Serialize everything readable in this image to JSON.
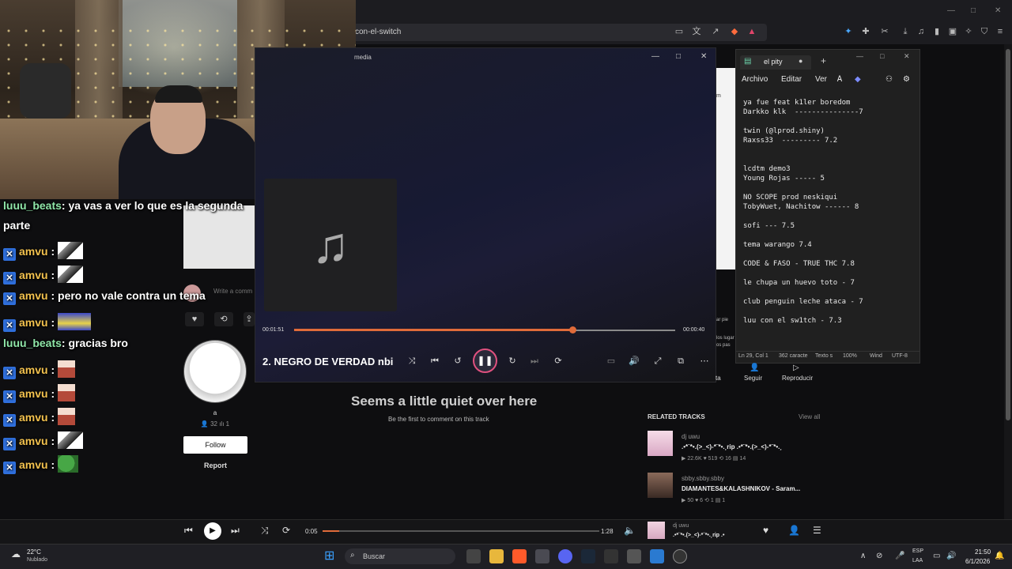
{
  "browser": {
    "url": "con-el-switch",
    "icons": [
      "screen-icon",
      "translate-icon",
      "share-icon",
      "brave-shield-icon",
      "rewards-icon",
      "extension-icon",
      "puzzle-icon",
      "download-icon",
      "music-icon",
      "sidebar-icon",
      "wallet-icon",
      "leo-icon",
      "vpn-icon",
      "menu-icon"
    ]
  },
  "chat": {
    "messages": [
      {
        "user": "luuu_beats",
        "text": ": ya vas a ver lo que es la segunda",
        "badge": false,
        "emote": ""
      },
      {
        "user": "",
        "text": "parte",
        "badge": false,
        "emote": ""
      },
      {
        "user": "amvu",
        "text": " :",
        "badge": true,
        "emote": "cat"
      },
      {
        "user": "amvu",
        "text": " :",
        "badge": true,
        "emote": "cat"
      },
      {
        "user": "amvu",
        "text": " : pero no vale contra un tema",
        "badge": true,
        "emote": ""
      },
      {
        "user": "amvu",
        "text": " :",
        "badge": true,
        "emote": "car"
      },
      {
        "user": "luuu_beats",
        "text": ": gracias bro",
        "badge": false,
        "emote": ""
      },
      {
        "user": "amvu",
        "text": " :",
        "badge": true,
        "emote": "anime"
      },
      {
        "user": "amvu",
        "text": " :",
        "badge": true,
        "emote": "anime"
      },
      {
        "user": "amvu",
        "text": " :",
        "badge": true,
        "emote": "anime"
      },
      {
        "user": "amvu",
        "text": " :",
        "badge": true,
        "emote": "cat"
      },
      {
        "user": "amvu",
        "text": " :",
        "badge": true,
        "emote": "frog"
      }
    ]
  },
  "profile": {
    "comment_placeholder": "Write a comm",
    "name": "a",
    "followers": "32",
    "tracks": "1",
    "follow_label": "Follow",
    "report_label": "Report"
  },
  "media": {
    "window_title": "media",
    "time_current": "00:01:51",
    "time_total": "00:00:40",
    "progress": 0.73,
    "track_title": "2. NEGRO DE VERDAD nbi"
  },
  "notepad": {
    "tab_title": "el pity",
    "menu": [
      "Archivo",
      "Editar",
      "Ver"
    ],
    "content": "ya fue feat k1ler boredom\nDarkko klk  ---------------7\n\ntwin (@lprod.shiny)\nRaxss33  --------- 7.2\n\n\nlcdtm demo3\nYoung Rojas ----- 5\n\nNO SCOPE prod neskiqui\nTobyWuet, Nachitow ------ 8\n\nsofi --- 7.5\n\ntema warango 7.4\n\nCODE & FASO - TRUE THC 7.8\n\nle chupa un huevo toto - 7\n\nclub penguin leche ataca - 7\n\nluu con el sw1tch - 7.3",
    "status": {
      "position": "Ln 29, Col 1",
      "chars": "362 caracte",
      "mode": "Texto s",
      "zoom": "100%",
      "line_ending": "Wind",
      "encoding": "UTF-8"
    }
  },
  "page": {
    "quiet_title": "Seems a little quiet over here",
    "quiet_sub": "Be the first to comment on this track",
    "follow_label": "Seguir",
    "play_label": "Reproducir",
    "left_cut_label": "ta",
    "related_header": "RELATED TRACKS",
    "related_viewall": "View all",
    "related": [
      {
        "artist": "dj uwu",
        "title": ".•*¨*•.(>_<)-*¨*•.¸rip .•*¨*•.(>_<)-*¨*•.¸",
        "plays": "22.6K",
        "likes": "519",
        "reposts": "16",
        "comments": "14",
        "thumb": "#e9c3d6"
      },
      {
        "artist": "sbby.sbby.sbby",
        "title": "DIAMANTES&KALASHNIKOV - Saram...",
        "plays": "50",
        "likes": "6",
        "reposts": "1",
        "comments": "1",
        "thumb": "#6b4a3e"
      }
    ],
    "side_text": [
      "los lugar",
      "os pas",
      "ar pie",
      "m"
    ]
  },
  "sc_player": {
    "time_current": "0:05",
    "time_total": "1:28",
    "progress": 0.06,
    "artist": "dj uwu",
    "title": ".•*¨*•.(>_<)-*¨*•.¸rip .•"
  },
  "taskbar": {
    "temp": "22°C",
    "weather": "Nublado",
    "search_label": "Buscar",
    "lang_top": "ESP",
    "lang_bottom": "LAA",
    "time": "21:50",
    "date": "6/1/2026"
  }
}
